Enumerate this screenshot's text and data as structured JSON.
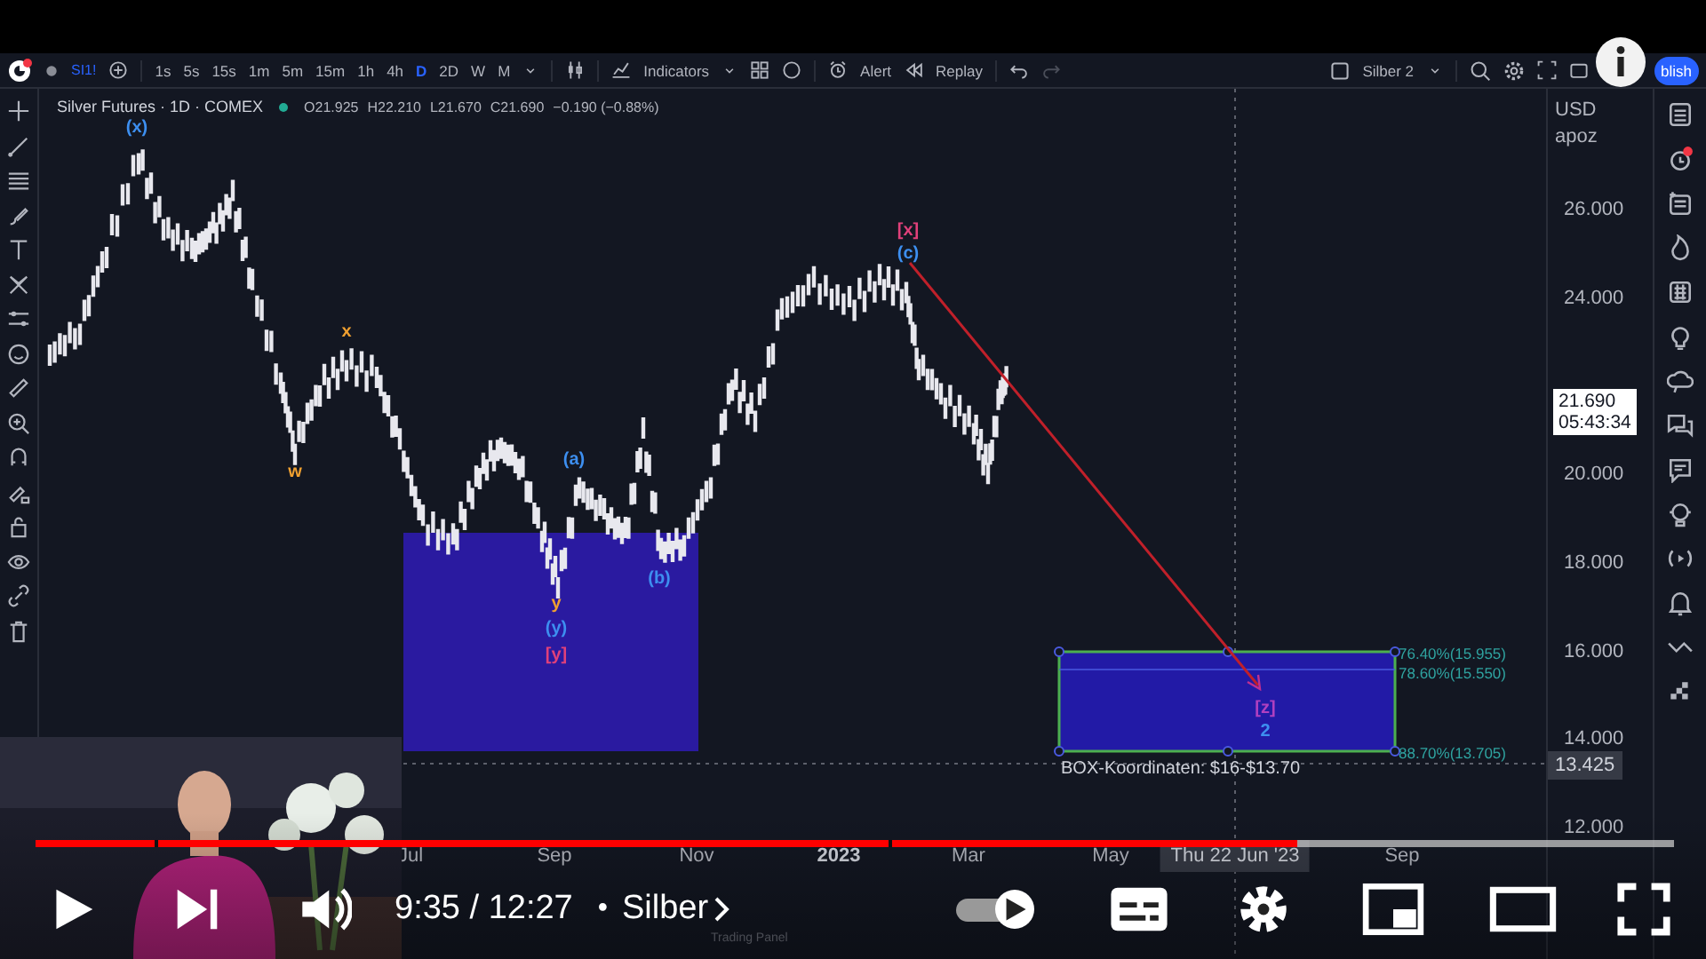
{
  "toolbar": {
    "symbol": "SI1!",
    "intervals": [
      {
        "label": "1s",
        "selected": false
      },
      {
        "label": "5s",
        "selected": false
      },
      {
        "label": "15s",
        "selected": false
      },
      {
        "label": "1m",
        "selected": false
      },
      {
        "label": "5m",
        "selected": false
      },
      {
        "label": "15m",
        "selected": false
      },
      {
        "label": "1h",
        "selected": false
      },
      {
        "label": "4h",
        "selected": false
      },
      {
        "label": "D",
        "selected": true
      },
      {
        "label": "2D",
        "selected": false
      },
      {
        "label": "W",
        "selected": false
      },
      {
        "label": "M",
        "selected": false
      }
    ],
    "indicators": "Indicators",
    "alert": "Alert",
    "replay": "Replay",
    "layout": "Silber 2",
    "publish": "blish"
  },
  "legend": {
    "title": "Silver Futures · 1D · COMEX",
    "open": "O21.925",
    "high": "H22.210",
    "low": "L21.670",
    "close": "C21.690",
    "change": "−0.190 (−0.88%)"
  },
  "chart": {
    "wave_labels": [
      {
        "text": "(x)",
        "color": "#3d8ff0"
      },
      {
        "text": "x",
        "color": "#f0a030"
      },
      {
        "text": "w",
        "color": "#f0a030"
      },
      {
        "text": "(a)",
        "color": "#3d8ff0"
      },
      {
        "text": "y",
        "color": "#f0a030"
      },
      {
        "text": "(y)",
        "color": "#3d8ff0"
      },
      {
        "text": "[y]",
        "color": "#e0407a"
      },
      {
        "text": "(b)",
        "color": "#3d8ff0"
      },
      {
        "text": "[x]",
        "color": "#e0407a"
      },
      {
        "text": "(c)",
        "color": "#3d8ff0"
      },
      {
        "text": "[z]",
        "color": "#b040c0"
      },
      {
        "text": "2",
        "color": "#3d8ff0"
      }
    ],
    "box_levels": [
      "76.40%(15.955)",
      "78.60%(15.550)",
      "88.70%(13.705)"
    ],
    "box_note": "BOX-Koordinaten: $16-$13.70"
  },
  "price_axis": {
    "currency": "USD",
    "unit": "apoz",
    "ticks": [
      "26.000",
      "24.000",
      "20.000",
      "18.000",
      "16.000",
      "14.000",
      "12.000"
    ],
    "last_price": "21.690",
    "countdown": "05:43:34",
    "crosshair_price": "13.425"
  },
  "time_axis": {
    "ticks": [
      {
        "label": "Jul",
        "kind": "month"
      },
      {
        "label": "Sep",
        "kind": "month"
      },
      {
        "label": "Nov",
        "kind": "month"
      },
      {
        "label": "2023",
        "kind": "year"
      },
      {
        "label": "Mar",
        "kind": "month"
      },
      {
        "label": "May",
        "kind": "month"
      },
      {
        "label": "Sep",
        "kind": "month"
      }
    ],
    "crosshair_date": "Thu 22 Jun '23"
  },
  "bottom_panel": {
    "label": "Trading Panel"
  },
  "player": {
    "progress": {
      "level": 0.77
    },
    "time": "9:35 / 12:27",
    "separator": "•",
    "chapter": "Silber",
    "autoplay": {
      "on": true
    }
  }
}
